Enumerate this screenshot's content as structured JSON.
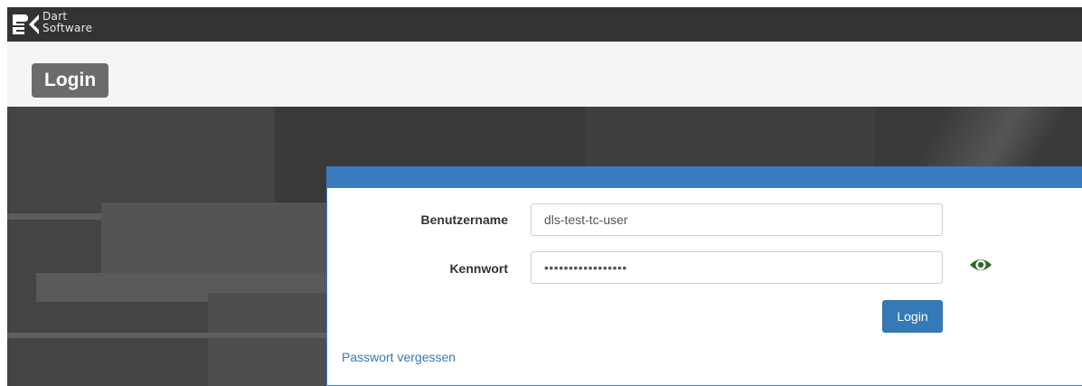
{
  "brand": {
    "line1": "Dart",
    "line2": "Software"
  },
  "header": {
    "title": "Login"
  },
  "form": {
    "username_label": "Benutzername",
    "username_value": "dls-test-tc-user",
    "password_label": "Kennwort",
    "password_value": "dls-test-tc-user1",
    "show_password_icon": "eye-icon",
    "submit_label": "Login",
    "forgot_link": "Passwort vergessen"
  },
  "colors": {
    "topbar": "#353232",
    "accent": "#337ab7",
    "eye_icon": "#2e6b2e"
  }
}
